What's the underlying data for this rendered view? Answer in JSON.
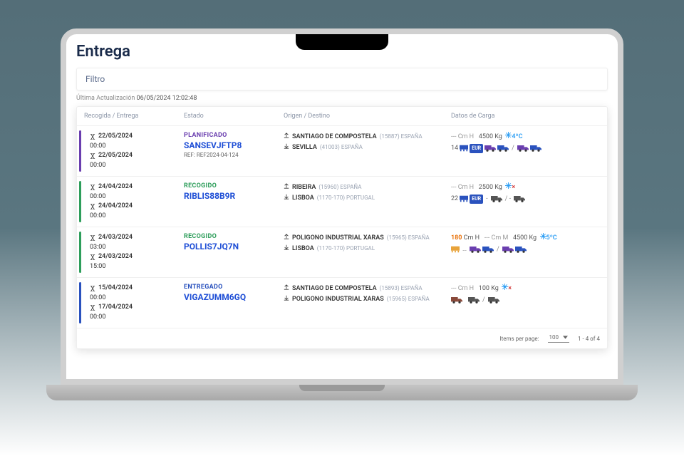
{
  "page_title": "Entrega",
  "filter_label": "Filtro",
  "last_update_label": "Última Actualización",
  "last_update_ts": "06/05/2024 12:02:48",
  "columns": {
    "date": "Recogida / Entrega",
    "state": "Estado",
    "route": "Origen / Destino",
    "cargo": "Datos de Carga"
  },
  "rows": [
    {
      "bar_color": "purple",
      "pickup_date": "22/05/2024",
      "pickup_time": "00:00",
      "delivery_date": "22/05/2024",
      "delivery_time": "00:00",
      "state": "PLANIFICADO",
      "state_class": "planificado",
      "code": "SANSEVJFTP8",
      "ref_label": "REF:",
      "ref": "REF2024-04-124",
      "origin_city": "SANTIAGO DE COMPOSTELA",
      "origin_meta": "(15887) ESPAÑA",
      "dest_city": "SEVILLA",
      "dest_meta": "(41003) ESPAÑA",
      "height": "--- Cm H",
      "weight": "4500 Kg",
      "temp": "4ºC",
      "temp_class": "hl-blue",
      "footprint": "14",
      "footprint_chip": "EUR",
      "transport_prefix": "",
      "transport_sep": "/"
    },
    {
      "bar_color": "green",
      "pickup_date": "24/04/2024",
      "pickup_time": "00:00",
      "delivery_date": "24/04/2024",
      "delivery_time": "00:00",
      "state": "RECOGIDO",
      "state_class": "recogido",
      "code": "RIBLIS88B9R",
      "ref_label": "",
      "ref": "",
      "origin_city": "RIBEIRA",
      "origin_meta": "(15960) ESPAÑA",
      "dest_city": "LISBOA",
      "dest_meta": "(1170-170) PORTUGAL",
      "height": "--- Cm H",
      "weight": "2500 Kg",
      "temp": "×",
      "temp_class": "hl-red",
      "footprint": "22",
      "footprint_chip": "EUR",
      "transport_prefix": "-",
      "transport_sep": "/ -"
    },
    {
      "bar_color": "green",
      "pickup_date": "24/03/2024",
      "pickup_time": "03:00",
      "delivery_date": "24/03/2024",
      "delivery_time": "15:00",
      "state": "RECOGIDO",
      "state_class": "recogido",
      "code": "POLLIS7JQ7N",
      "ref_label": "",
      "ref": "",
      "origin_city": "POLIGONO INDUSTRIAL XARAS",
      "origin_meta": "(15965) ESPAÑA",
      "dest_city": "LISBOA",
      "dest_meta": "(1170-170) PORTUGAL",
      "height_val": "180",
      "height": "Cm H",
      "weight_pre": "--- Cm M",
      "weight": "4500 Kg",
      "temp": "5ºC",
      "temp_class": "hl-blue",
      "footprint": "",
      "footprint_chip": "",
      "transport_prefix": "",
      "transport_sep": "/"
    },
    {
      "bar_color": "blue",
      "pickup_date": "15/04/2024",
      "pickup_time": "00:00",
      "delivery_date": "17/04/2024",
      "delivery_time": "00:00",
      "state": "ENTREGADO",
      "state_class": "entregado",
      "code": "VIGAZUMM6GQ",
      "ref_label": "",
      "ref": "",
      "origin_city": "SANTIAGO DE COMPOSTELA",
      "origin_meta": "(15893) ESPAÑA",
      "dest_city": "POLIGONO INDUSTRIAL XARAS",
      "dest_meta": "(15965) ESPAÑA",
      "height": "--- Cm H",
      "weight": "100 Kg",
      "temp": "×",
      "temp_class": "hl-red",
      "footprint": "",
      "footprint_chip": "",
      "transport_prefix": "",
      "transport_sep": "/"
    }
  ],
  "pager": {
    "items_label": "Items per page:",
    "per_page": "100",
    "range": "1 - 4 of 4"
  },
  "colors": {
    "planificado": "#6a3eaf",
    "recogido": "#2e9e5b",
    "entregado": "#2a52be",
    "link": "#1f4fd6"
  }
}
